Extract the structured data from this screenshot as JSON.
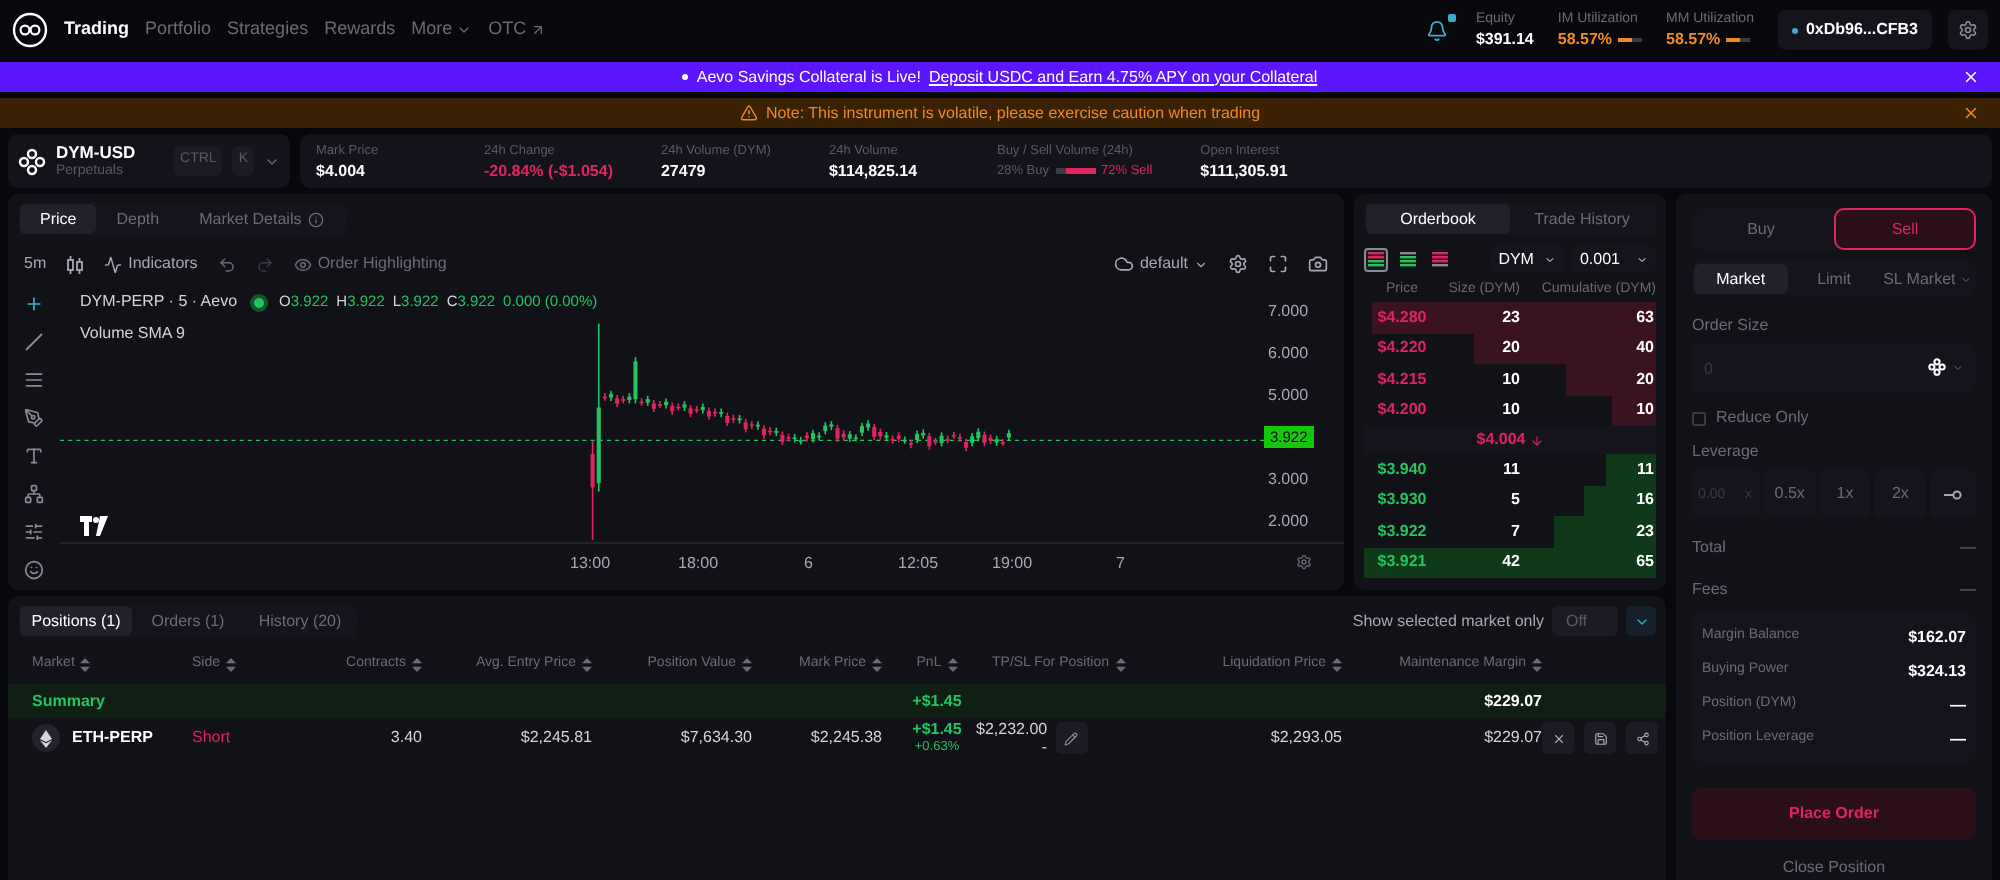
{
  "nav": {
    "items": [
      {
        "label": "Trading",
        "selected": true
      },
      {
        "label": "Portfolio",
        "selected": false
      },
      {
        "label": "Strategies",
        "selected": false
      },
      {
        "label": "Rewards",
        "selected": false
      }
    ],
    "more": "More",
    "otc": "OTC"
  },
  "account": {
    "equity": {
      "label": "Equity",
      "value": "$391.14"
    },
    "meters": [
      {
        "label": "IM Utilization",
        "value": "58.57%",
        "level": 0.5857
      },
      {
        "label": "MM Utilization",
        "value": "58.57%",
        "level": 0.5857
      }
    ],
    "wallet": "0xDb96...CFB3"
  },
  "banner": {
    "text": "Aevo Savings Collateral is Live!",
    "link": "Deposit USDC and Earn 4.75% APY on your Collateral"
  },
  "note": "Note: This instrument is volatile, please exercise caution when trading",
  "instrument": {
    "symbol": "DYM-USD",
    "type": "Perpetuals",
    "keys": [
      "CTRL",
      "K"
    ]
  },
  "stats": [
    {
      "label": "Mark Price",
      "value": "$4.004",
      "kind": "plain"
    },
    {
      "label": "24h Change",
      "value": "-20.84% (-$1.054)",
      "kind": "negative"
    },
    {
      "label": "24h Volume (DYM)",
      "value": "27479",
      "kind": "plain"
    },
    {
      "label": "24h Volume",
      "value": "$114,825.14",
      "kind": "plain"
    },
    {
      "label": "Buy / Sell Volume (24h)",
      "kind": "ratio",
      "buy": "28% Buy",
      "sell": "72% Sell",
      "level": 0.28
    },
    {
      "label": "Open Interest",
      "value": "$111,305.91",
      "kind": "plain"
    }
  ],
  "chart_tabs": [
    {
      "label": "Price",
      "selected": true
    },
    {
      "label": "Depth",
      "selected": false
    },
    {
      "label": "Market Details",
      "selected": false
    }
  ],
  "toolbar": {
    "interval": "5m",
    "indicators": "Indicators",
    "highlighting": "Order Highlighting",
    "layout": "default"
  },
  "legend": {
    "title": "DYM-PERP · 5 · Aevo",
    "ohlc": [
      {
        "key": "O",
        "value": "3.922"
      },
      {
        "key": "H",
        "value": "3.922"
      },
      {
        "key": "L",
        "value": "3.922"
      },
      {
        "key": "C",
        "value": "3.922"
      }
    ],
    "change": "0.000 (0.00%)",
    "study": "Volume SMA 9"
  },
  "y_ticks": [
    {
      "label": "7.000",
      "kind": "tick"
    },
    {
      "label": "6.000",
      "kind": "tick"
    },
    {
      "label": "5.000",
      "kind": "tick"
    },
    {
      "label": "3.922",
      "kind": "last_price"
    },
    {
      "label": "3.000",
      "kind": "tick"
    },
    {
      "label": "2.000",
      "kind": "tick"
    }
  ],
  "x_ticks": [
    "13:00",
    "18:00",
    "6",
    "12:05",
    "19:00",
    "7"
  ],
  "orderbook": {
    "tabs": [
      {
        "label": "Orderbook",
        "selected": true
      },
      {
        "label": "Trade History",
        "selected": false
      }
    ],
    "views": [
      {
        "kind": "both",
        "selected": true
      },
      {
        "kind": "bids",
        "selected": false
      },
      {
        "kind": "asks",
        "selected": false
      }
    ],
    "asset": "DYM",
    "tick": "0.001",
    "columns": [
      "Price",
      "Size (DYM)",
      "Cumulative (DYM)"
    ],
    "asks": [
      {
        "price": "$4.280",
        "size": "23",
        "total": "63",
        "level": 0.97
      },
      {
        "price": "$4.220",
        "size": "20",
        "total": "40",
        "level": 0.62
      },
      {
        "price": "$4.215",
        "size": "10",
        "total": "20",
        "level": 0.31
      },
      {
        "price": "$4.200",
        "size": "10",
        "total": "10",
        "level": 0.15
      }
    ],
    "mid": "$4.004",
    "bids": [
      {
        "price": "$3.940",
        "size": "11",
        "total": "11",
        "level": 0.17
      },
      {
        "price": "$3.930",
        "size": "5",
        "total": "16",
        "level": 0.25
      },
      {
        "price": "$3.922",
        "size": "7",
        "total": "23",
        "level": 0.35
      },
      {
        "price": "$3.921",
        "size": "42",
        "total": "65",
        "level": 1
      }
    ]
  },
  "order": {
    "sides": [
      {
        "label": "Buy",
        "selected": false
      },
      {
        "label": "Sell",
        "selected": true
      }
    ],
    "types": [
      {
        "label": "Market",
        "selected": true
      },
      {
        "label": "Limit",
        "selected": false
      },
      {
        "label": "SL Market",
        "selected": false
      }
    ],
    "size_label": "Order Size",
    "size_placeholder": "0",
    "reduce_only": {
      "label": "Reduce Only",
      "checked": false
    },
    "leverage_label": "Leverage",
    "leverage_placeholder": "0.00",
    "leverage_unit": "x",
    "leverage_options": [
      "0.5x",
      "1x",
      "2x"
    ],
    "totals": [
      {
        "label": "Total",
        "value": "—"
      },
      {
        "label": "Fees",
        "value": "—"
      }
    ],
    "summary": [
      {
        "label": "Margin Balance",
        "value": "$162.07"
      },
      {
        "label": "Buying Power",
        "value": "$324.13"
      },
      {
        "label": "Position (DYM)",
        "value": "—"
      },
      {
        "label": "Position Leverage",
        "value": "—"
      }
    ],
    "submit": "Place Order",
    "close": "Close Position"
  },
  "positions": {
    "tabs": [
      {
        "label": "Positions (1)",
        "selected": true
      },
      {
        "label": "Orders (1)",
        "selected": false
      },
      {
        "label": "History (20)",
        "selected": false
      }
    ],
    "filter": {
      "label": "Show selected market only",
      "value": "Off",
      "on": false
    },
    "columns": [
      "Market",
      "Side",
      "Contracts",
      "Avg. Entry Price",
      "Position Value",
      "Mark Price",
      "PnL",
      "TP/SL For Position",
      "Liquidation Price",
      "Maintenance Margin"
    ],
    "summary": {
      "label": "Summary",
      "pnl": "+$1.45",
      "maintenance_margin": "$229.07"
    },
    "rows": [
      {
        "market": "ETH-PERP",
        "side": "Short",
        "kind": "short",
        "contracts": "3.40",
        "avg_entry_price": "$2,245.81",
        "position_value": "$7,634.30",
        "mark_price": "$2,245.38",
        "pnl": "+$1.45",
        "pnl_percent": "+0.63%",
        "tp": "$2,232.00",
        "sl": "-",
        "liquidation_price": "$2,293.05",
        "maintenance_margin": "$229.07"
      }
    ]
  }
}
